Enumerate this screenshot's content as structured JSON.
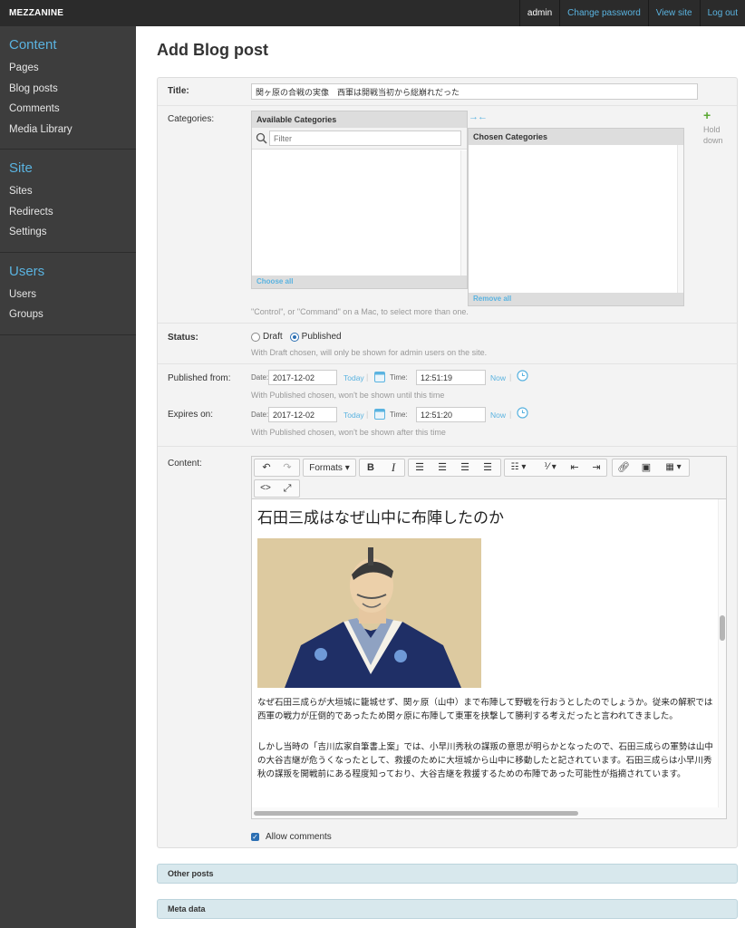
{
  "brand": "MEZZANINE",
  "topbar": {
    "user": "admin",
    "change_password": "Change password",
    "view_site": "View site",
    "log_out": "Log out"
  },
  "sidebar": {
    "sections": [
      {
        "title": "Content",
        "items": [
          "Pages",
          "Blog posts",
          "Comments",
          "Media Library"
        ]
      },
      {
        "title": "Site",
        "items": [
          "Sites",
          "Redirects",
          "Settings"
        ]
      },
      {
        "title": "Users",
        "items": [
          "Users",
          "Groups"
        ]
      }
    ]
  },
  "page_title": "Add Blog post",
  "form": {
    "title_label": "Title:",
    "title_value": "関ヶ原の合戦の実像　西軍は開戦当初から総崩れだった",
    "categories_label": "Categories:",
    "available_header": "Available Categories",
    "filter_placeholder": "Filter",
    "choose_all": "Choose all",
    "chosen_header": "Chosen Categories",
    "remove_all": "Remove all",
    "hold_label": "Hold down",
    "categories_help": "\"Control\", or \"Command\" on a Mac, to select more than one.",
    "status_label": "Status:",
    "status_draft": "Draft",
    "status_published": "Published",
    "status_selected": "Published",
    "status_help": "With Draft chosen, will only be shown for admin users on the site.",
    "published_label": "Published from:",
    "date_label": "Date:",
    "time_label": "Time:",
    "published_date": "2017-12-02",
    "published_time": "12:51:19",
    "today": "Today",
    "now": "Now",
    "published_help": "With Published chosen, won't be shown until this time",
    "expires_label": "Expires on:",
    "expires_date": "2017-12-02",
    "expires_time": "12:51:20",
    "expires_help": "With Published chosen, won't be shown after this time",
    "content_label": "Content:",
    "allow_comments": "Allow comments",
    "allow_comments_checked": true
  },
  "editor": {
    "formats_label": "Formats",
    "heading": "石田三成はなぜ山中に布陣したのか",
    "paragraph1": "なぜ石田三成らが大垣城に籠城せず、関ヶ原（山中）まで布陣して野戦を行おうとしたのでしょうか。従来の解釈では西軍の戦力が圧倒的であったため関ヶ原に布陣して東軍を挟撃して勝利する考えだったと言われてきました。",
    "paragraph2": "しかし当時の「吉川広家自筆書上案」では、小早川秀秋の謀叛の意思が明らかとなったので、石田三成らの軍勢は山中の大谷吉継が危うくなったとして、救援のために大垣城から山中に移動したと記されています。石田三成らは小早川秀秋の謀叛を開戦前にある程度知っており、大谷吉継を救援するための布陣であった可能性が指摘されています。"
  },
  "collapsibles": [
    "Other posts",
    "Meta data"
  ],
  "colors": {
    "accent": "#5ab3e0",
    "sidebar": "#3d3d3d",
    "topbar": "#2b2b2b",
    "panel": "#d8e8ed"
  }
}
